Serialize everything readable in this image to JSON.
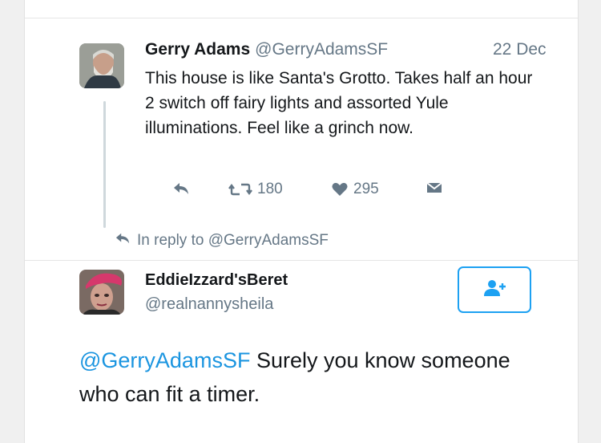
{
  "tweet1": {
    "author_name": "Gerry Adams",
    "author_handle": "@GerryAdamsSF",
    "date": "22 Dec",
    "text": "This house is like Santa's Grotto. Takes half an hour 2 switch off fairy lights and assorted Yule illuminations. Feel like a grinch now.",
    "retweet_count": "180",
    "like_count": "295"
  },
  "reply_context": {
    "label": "In reply to @GerryAdamsSF"
  },
  "tweet2": {
    "author_name": "EddieIzzard'sBeret",
    "author_handle": "@realnannysheila",
    "mention": "@GerryAdamsSF",
    "text": " Surely you know someone who can fit a timer."
  },
  "colors": {
    "link_blue": "#1b95e0",
    "follow_blue": "#1da1f2",
    "muted_gray": "#657786",
    "text_dark": "#14171a"
  },
  "icons": [
    "reply-icon",
    "retweet-icon",
    "heart-icon",
    "direct-message-icon",
    "follow-user-icon"
  ]
}
